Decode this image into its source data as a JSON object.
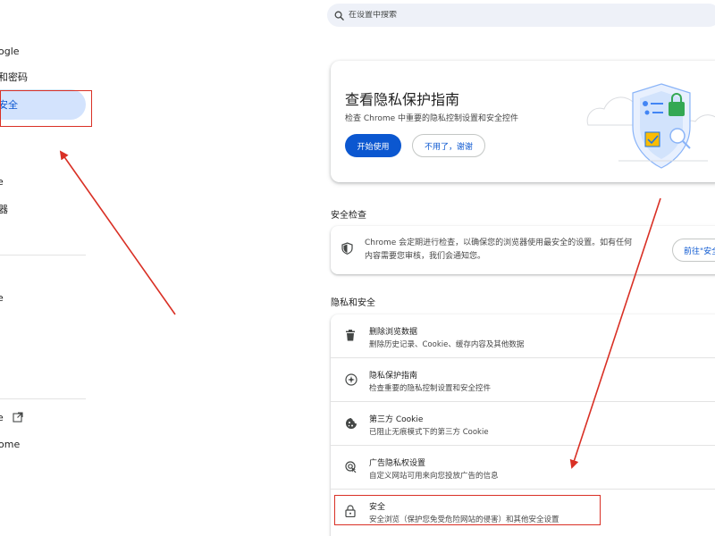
{
  "search": {
    "placeholder": "在设置中搜索"
  },
  "sidebar": {
    "items": [
      {
        "label": "ogle"
      },
      {
        "label": "和密码"
      },
      {
        "label": "安全"
      },
      {
        "label": ""
      },
      {
        "label": "e"
      },
      {
        "label": "器"
      },
      {
        "label": ""
      },
      {
        "label": "e"
      },
      {
        "label": ""
      },
      {
        "label": ""
      },
      {
        "label": ""
      },
      {
        "label": "ome"
      }
    ]
  },
  "promo": {
    "title": "查看隐私保护指南",
    "subtitle": "检查 Chrome 中重要的隐私控制设置和安全控件",
    "start_label": "开始使用",
    "dismiss_label": "不用了，谢谢"
  },
  "safety_check": {
    "heading": "安全检查",
    "line1": "Chrome 会定期进行检查，以确保您的浏览器使用最安全的设置。如有任何",
    "line2": "内容需要您审核，我们会通知您。",
    "button_label": "前往\"安全"
  },
  "privacy": {
    "heading": "隐私和安全",
    "rows": [
      {
        "title": "删除浏览数据",
        "subtitle": "删除历史记录、Cookie、缓存内容及其他数据",
        "icon": "trash-icon"
      },
      {
        "title": "隐私保护指南",
        "subtitle": "检查重要的隐私控制设置和安全控件",
        "icon": "compass-icon"
      },
      {
        "title": "第三方 Cookie",
        "subtitle": "已阻止无痕模式下的第三方 Cookie",
        "icon": "cookie-icon"
      },
      {
        "title": "广告隐私权设置",
        "subtitle": "自定义网站可用来向您投放广告的信息",
        "icon": "ad-privacy-icon"
      },
      {
        "title": "安全",
        "subtitle": "安全浏览（保护您免受危险网站的侵害）和其他安全设置",
        "icon": "lock-icon"
      }
    ]
  },
  "colors": {
    "accent": "#0b57d0",
    "selected_bg": "#d3e3fd",
    "annotation_red": "#d93025"
  }
}
